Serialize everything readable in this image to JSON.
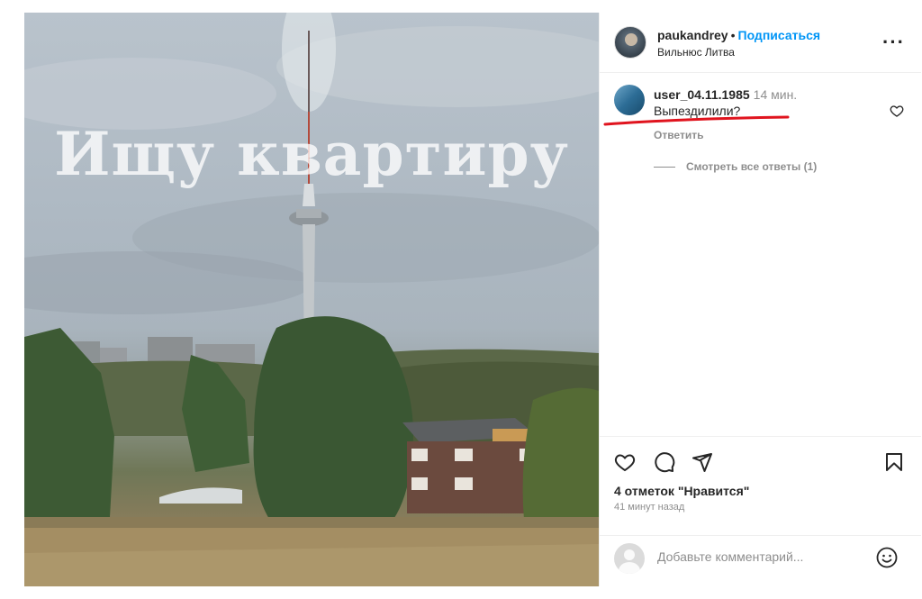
{
  "post": {
    "overlay_text": "Ищу квартиру"
  },
  "header": {
    "author": "paukandrey",
    "separator": "•",
    "follow_label": "Подписаться",
    "location": "Вильнюс Литва",
    "more_label": "···"
  },
  "comment": {
    "user": "user_04.11.1985",
    "time": "14 мин.",
    "text": "Выпездилили?",
    "reply_label": "Ответить",
    "view_replies_label": "Смотреть все ответы (1)"
  },
  "actions": {
    "icons": [
      "heart-icon",
      "comment-icon",
      "share-icon",
      "bookmark-icon"
    ],
    "likes": "4 отметок \"Нравится\"",
    "posted": "41 минут назад"
  },
  "add_comment": {
    "placeholder": "Добавьте комментарий..."
  },
  "colors": {
    "follow": "#0095f6",
    "annotation_underline": "#e0141e",
    "secondary_text": "#8e8e8e"
  }
}
